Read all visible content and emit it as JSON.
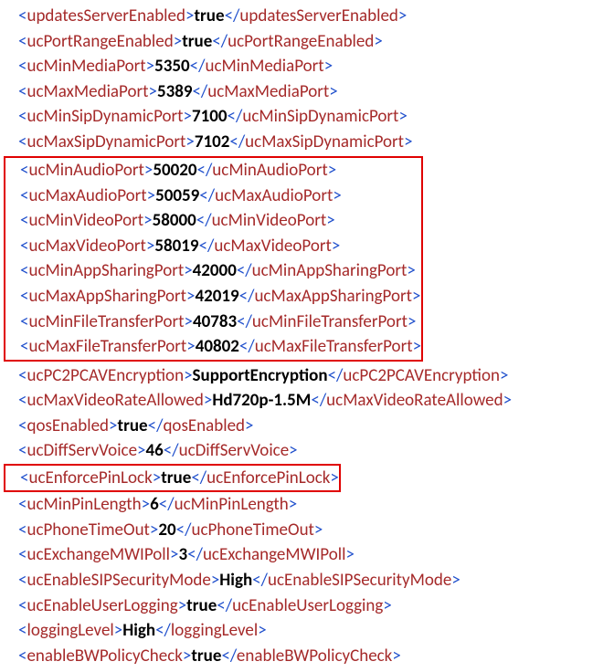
{
  "lines": [
    {
      "tag": "updatesServerEnabled",
      "value": "true"
    },
    {
      "tag": "ucPortRangeEnabled",
      "value": "true"
    },
    {
      "tag": "ucMinMediaPort",
      "value": "5350"
    },
    {
      "tag": "ucMaxMediaPort",
      "value": "5389"
    },
    {
      "tag": "ucMinSipDynamicPort",
      "value": "7100"
    },
    {
      "tag": "ucMaxSipDynamicPort",
      "value": "7102"
    },
    {
      "tag": "ucMinAudioPort",
      "value": "50020"
    },
    {
      "tag": "ucMaxAudioPort",
      "value": "50059"
    },
    {
      "tag": "ucMinVideoPort",
      "value": "58000"
    },
    {
      "tag": "ucMaxVideoPort",
      "value": "58019"
    },
    {
      "tag": "ucMinAppSharingPort",
      "value": "42000"
    },
    {
      "tag": "ucMaxAppSharingPort",
      "value": "42019"
    },
    {
      "tag": "ucMinFileTransferPort",
      "value": "40783"
    },
    {
      "tag": "ucMaxFileTransferPort",
      "value": "40802"
    },
    {
      "tag": "ucPC2PCAVEncryption",
      "value": "SupportEncryption"
    },
    {
      "tag": "ucMaxVideoRateAllowed",
      "value": "Hd720p-1.5M"
    },
    {
      "tag": "qosEnabled",
      "value": "true"
    },
    {
      "tag": "ucDiffServVoice",
      "value": "46"
    },
    {
      "tag": "ucEnforcePinLock",
      "value": "true"
    },
    {
      "tag": "ucMinPinLength",
      "value": "6"
    },
    {
      "tag": "ucPhoneTimeOut",
      "value": "20"
    },
    {
      "tag": "ucExchangeMWIPoll",
      "value": "3"
    },
    {
      "tag": "ucEnableSIPSecurityMode",
      "value": "High"
    },
    {
      "tag": "ucEnableUserLogging",
      "value": "true"
    },
    {
      "tag": "loggingLevel",
      "value": "High"
    },
    {
      "tag": "enableBWPolicyCheck",
      "value": "true"
    }
  ],
  "boxed_group_start": 6,
  "boxed_group_end": 13,
  "boxed_single": 18
}
